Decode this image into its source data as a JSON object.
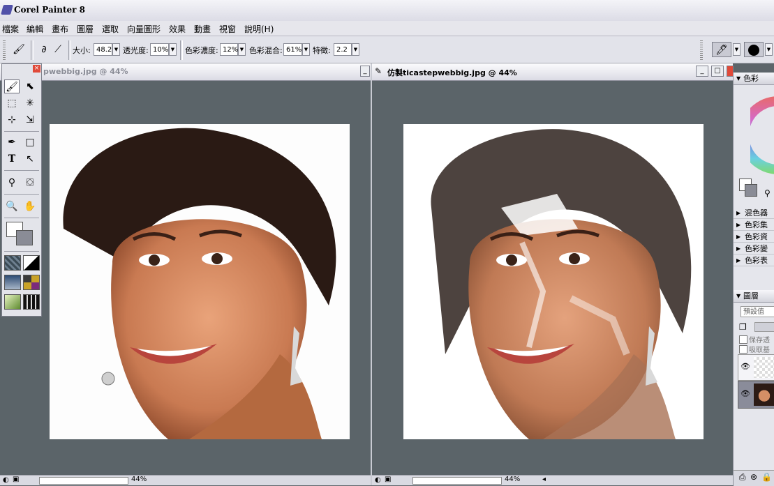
{
  "app": {
    "title": "Corel Painter 8"
  },
  "menu": [
    "檔案",
    "編輯",
    "畫布",
    "圖層",
    "選取",
    "向量圖形",
    "效果",
    "動畫",
    "視窗",
    "說明(H)"
  ],
  "property_bar": {
    "size_label": "大小:",
    "size_value": "48.2",
    "opacity_label": "透光度:",
    "opacity_value": "10%",
    "resat_label": "色彩濃度:",
    "resat_value": "12%",
    "bleed_label": "色彩混合:",
    "bleed_value": "61%",
    "feature_label": "特徵:",
    "feature_value": "2.2"
  },
  "documents": {
    "left": {
      "title": "pwebbig.jpg @ 44%",
      "zoom": "44%"
    },
    "right": {
      "title": "仿製ticastepwebbig.jpg @ 44%",
      "zoom": "44%"
    }
  },
  "palette": {
    "color_header": "色彩",
    "sections": [
      "混色器",
      "色彩集",
      "色彩資",
      "色彩變",
      "色彩表"
    ],
    "layers_header": "圖層",
    "layers_preset": "預設值",
    "preserve_label": "保存透",
    "pickup_label": "吸取基"
  },
  "colors": {
    "accent": "#5a5cb0",
    "canvas_bg": "#5b6469",
    "close_red": "#e04a3a"
  },
  "icons": [
    "brush-icon",
    "move-icon",
    "zoom-icon",
    "grabber-icon",
    "eye-icon"
  ]
}
